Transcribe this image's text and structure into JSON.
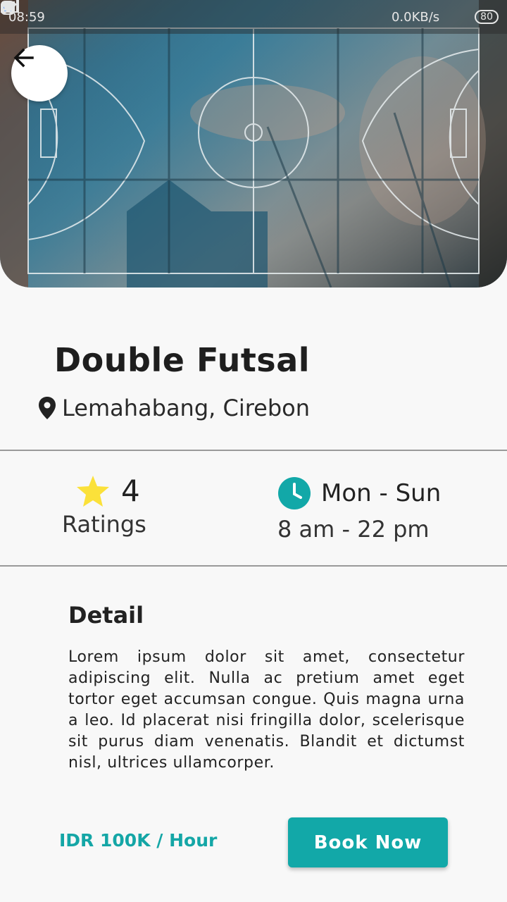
{
  "status_bar": {
    "time": "08:59",
    "net_speed": "0.0KB/s",
    "battery": "80"
  },
  "hero": {
    "image": "futsal-court-photo"
  },
  "venue": {
    "name": "Double Futsal",
    "location": "Lemahabang, Cirebon"
  },
  "rating": {
    "value": "4",
    "label": "Ratings"
  },
  "hours": {
    "days": "Mon - Sun",
    "time": "8 am - 22 pm"
  },
  "detail": {
    "title": "Detail",
    "text": "Lorem ipsum dolor sit amet, consectetur adipiscing elit. Nulla ac pretium amet eget tortor eget accumsan congue. Quis magna urna a leo. Id placerat nisi fringilla dolor, scelerisque sit purus diam venenatis. Blandit et dictumst nisl, ultrices ullamcorper."
  },
  "footer": {
    "price": "IDR 100K / Hour",
    "book_label": "Book Now"
  },
  "colors": {
    "accent": "#12a8a8",
    "star": "#fbe13a"
  },
  "icons": {
    "back": "arrow-left-icon",
    "location": "map-pin-icon",
    "rating": "star-icon",
    "hours": "clock-icon"
  }
}
